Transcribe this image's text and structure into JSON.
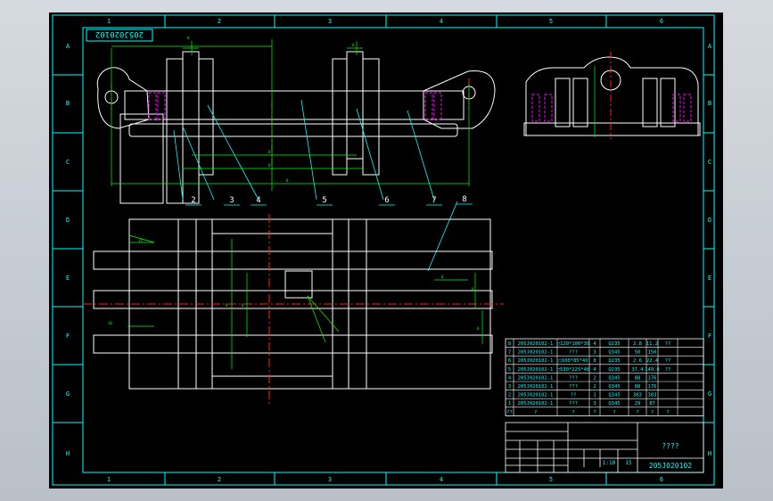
{
  "colors": {
    "background": "#000000",
    "frame": "#00ffff",
    "geometry": "#ffffff",
    "dimension": "#00ff00",
    "centerline": "#ff2020",
    "hidden": "#ff00ff"
  },
  "drawing": {
    "drawing_number_stamp": "205J020102",
    "grid_columns": [
      "1",
      "2",
      "3",
      "4",
      "5",
      "6"
    ],
    "grid_rows": [
      "A",
      "B",
      "C",
      "D",
      "E",
      "F",
      "G",
      "H"
    ],
    "part_balloons": [
      "2",
      "3",
      "4",
      "5",
      "6",
      "7",
      "8"
    ]
  },
  "parts_list": [
    {
      "no": "8",
      "code": "205J020102-1",
      "name": "□120*100*30",
      "qty": "4",
      "material": "Q235",
      "unit": "2.8",
      "total": "11.2",
      "note": "??"
    },
    {
      "no": "7",
      "code": "205J020102-1",
      "name": "???",
      "qty": "3",
      "material": "Q345",
      "unit": "50",
      "total": "150",
      "note": ""
    },
    {
      "no": "6",
      "code": "205J020102-1",
      "name": "□100*85*40",
      "qty": "8",
      "material": "Q235",
      "unit": "2.6",
      "total": "22.4",
      "note": "??"
    },
    {
      "no": "5",
      "code": "205J020102-1",
      "name": "□530*225*40",
      "qty": "4",
      "material": "Q235",
      "unit": "37.4",
      "total": "149.6",
      "note": "??"
    },
    {
      "no": "4",
      "code": "205J020102-1",
      "name": "???",
      "qty": "2",
      "material": "Q345",
      "unit": "88",
      "total": "176",
      "note": ""
    },
    {
      "no": "3",
      "code": "205J020102-1",
      "name": "???",
      "qty": "2",
      "material": "Q345",
      "unit": "88",
      "total": "176",
      "note": ""
    },
    {
      "no": "2",
      "code": "205J020102-1",
      "name": "??",
      "qty": "1",
      "material": "Q345",
      "unit": "383",
      "total": "383",
      "note": ""
    },
    {
      "no": "1",
      "code": "205J020102-1",
      "name": "???",
      "qty": "3",
      "material": "Q345",
      "unit": "29",
      "total": "87",
      "note": ""
    }
  ],
  "parts_header": [
    "??",
    "?",
    "?",
    "?",
    "?",
    "?",
    "?",
    "?"
  ],
  "title_block": {
    "title": "????",
    "number": "205J020102",
    "scale": "1:10",
    "sheet": "15"
  }
}
